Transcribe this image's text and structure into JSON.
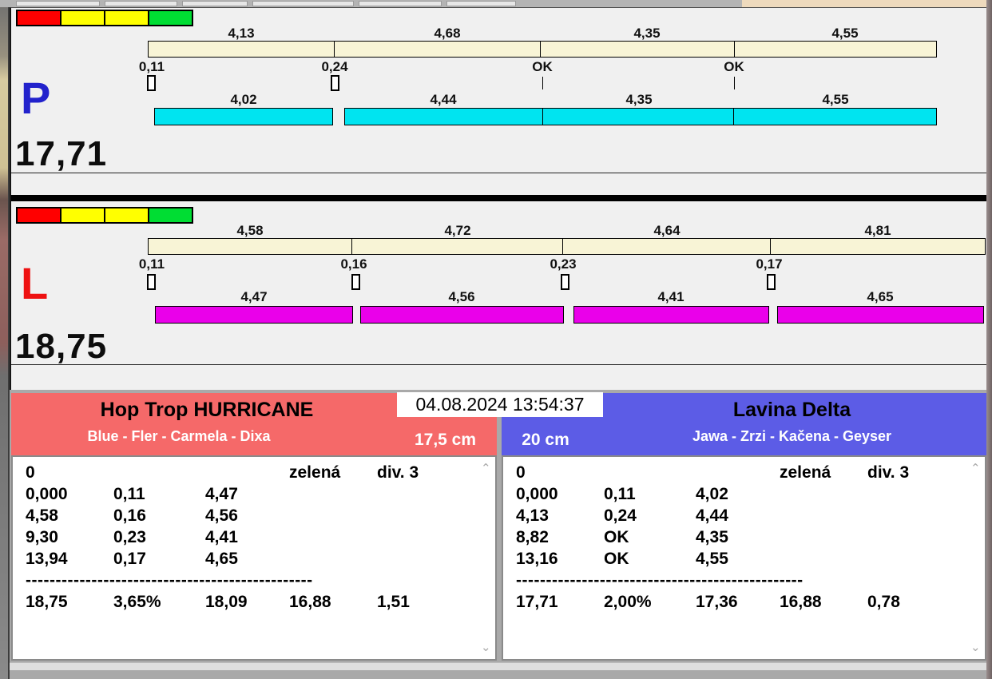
{
  "window": {
    "datetime": "04.08.2024 13:54:37"
  },
  "colors": {
    "cream": "#f8f4d6",
    "cyan": "#00e4f0",
    "magenta": "#ea00ea",
    "light_red": "#ff0000",
    "light_yellow": "#ffff00",
    "light_green": "#00dd33",
    "header_red": "#f56969",
    "header_blue": "#5c5ce6",
    "p_letter_blue": "#2222cc",
    "l_letter_red": "#ee1111"
  },
  "icons": {
    "chevron_up": "⌃",
    "chevron_down": "⌄"
  },
  "panel_p": {
    "letter": "P",
    "total": "17,71",
    "upper": [
      "4,13",
      "4,68",
      "4,35",
      "4,55"
    ],
    "mid": [
      "0,11",
      "0,24",
      "OK",
      "OK"
    ],
    "lower": [
      "4,02",
      "4,44",
      "4,35",
      "4,55"
    ]
  },
  "panel_l": {
    "letter": "L",
    "total": "18,75",
    "upper": [
      "4,58",
      "4,72",
      "4,64",
      "4,81"
    ],
    "mid": [
      "0,11",
      "0,16",
      "0,23",
      "0,17"
    ],
    "lower": [
      "4,47",
      "4,56",
      "4,41",
      "4,65"
    ]
  },
  "team_left": {
    "name": "Hop Trop HURRICANE",
    "dogs": "Blue - Fler - Carmela - Dixa",
    "height": "17,5 cm",
    "rows": [
      [
        "0",
        "",
        "",
        "zelená",
        "div. 3"
      ],
      [
        "0,000",
        "0,11",
        "4,47",
        "",
        ""
      ],
      [
        "4,58",
        "0,16",
        "4,56",
        "",
        ""
      ],
      [
        "9,30",
        "0,23",
        "4,41",
        "",
        ""
      ],
      [
        "13,94",
        "0,17",
        "4,65",
        "",
        ""
      ],
      [
        "------------------------------------------------"
      ],
      [
        "18,75",
        "3,65%",
        "18,09",
        "16,88",
        "1,51"
      ]
    ]
  },
  "team_right": {
    "name": "Lavina Delta",
    "dogs": "Jawa - Zrzi - Kačena - Geyser",
    "height": "20 cm",
    "rows": [
      [
        "0",
        "",
        "",
        "zelená",
        "div. 3"
      ],
      [
        "0,000",
        "0,11",
        "4,02",
        "",
        ""
      ],
      [
        "4,13",
        "0,24",
        "4,44",
        "",
        ""
      ],
      [
        "8,82",
        "OK",
        "4,35",
        "",
        ""
      ],
      [
        "13,16",
        "OK",
        "4,55",
        "",
        ""
      ],
      [
        "------------------------------------------------"
      ],
      [
        "17,71",
        "2,00%",
        "17,36",
        "16,88",
        "0,78"
      ]
    ]
  }
}
